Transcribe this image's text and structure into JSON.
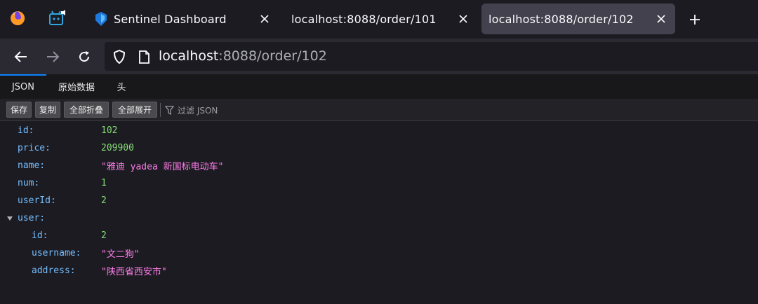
{
  "tabs": [
    {
      "title": "Sentinel Dashboard",
      "favicon": "sentinel-logo-icon"
    },
    {
      "title": "localhost:8088/order/101",
      "favicon": ""
    },
    {
      "title": "localhost:8088/order/102",
      "favicon": "",
      "active": true
    }
  ],
  "url": {
    "host": "localhost",
    "rest": ":8088/order/102"
  },
  "viewer_tabs": [
    "JSON",
    "原始数据",
    "头"
  ],
  "toolbar": {
    "save": "保存",
    "copy": "复制",
    "collapse_all": "全部折叠",
    "expand_all": "全部展开",
    "filter_placeholder": "过滤 JSON"
  },
  "json": {
    "id": {
      "key": "id:",
      "value": "102"
    },
    "price": {
      "key": "price:",
      "value": "209900"
    },
    "name": {
      "key": "name:",
      "value": "\"雅迪 yadea 新国标电动车\""
    },
    "num": {
      "key": "num:",
      "value": "1"
    },
    "userId": {
      "key": "userId:",
      "value": "2"
    },
    "user": {
      "key": "user:",
      "id": {
        "key": "id:",
        "value": "2"
      },
      "username": {
        "key": "username:",
        "value": "\"文二狗\""
      },
      "address": {
        "key": "address:",
        "value": "\"陕西省西安市\""
      }
    }
  },
  "colors": {
    "key": "#75bfff",
    "number": "#86de74",
    "string": "#ff7de9",
    "accent": "#0a84ff"
  }
}
